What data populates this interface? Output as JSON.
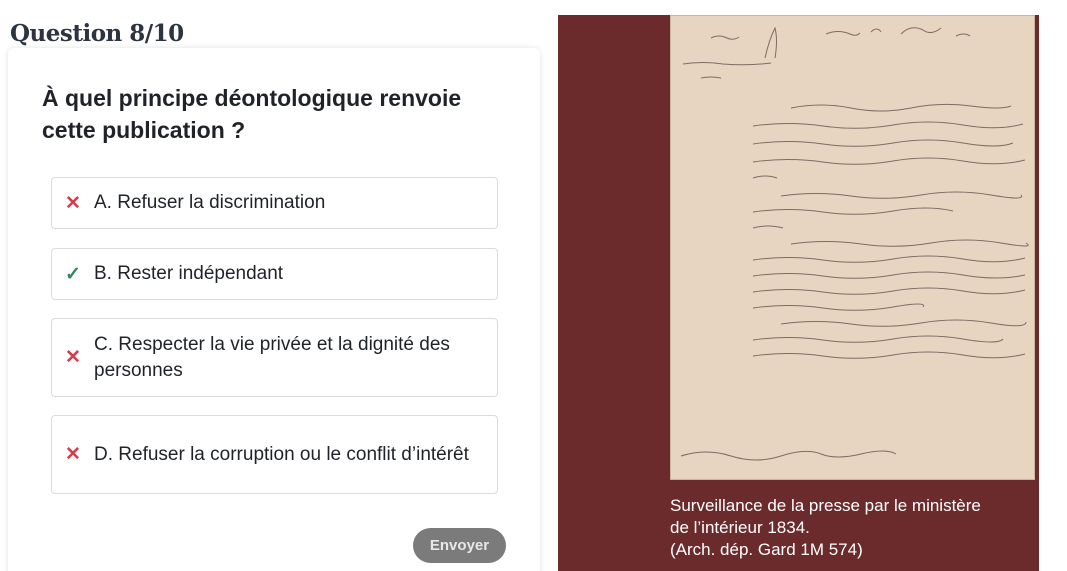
{
  "quiz": {
    "counter": "Question 8/10",
    "question": "À quel principe déontologique renvoie cette publication ?",
    "answers": [
      {
        "letter": "A.",
        "text": "A. Refuser la discrimination",
        "status": "wrong",
        "mark": "✕"
      },
      {
        "letter": "B.",
        "text": "B. Rester indépendant",
        "status": "correct",
        "mark": "✓"
      },
      {
        "letter": "C.",
        "text": "C. Respecter la vie privée et la dignité des personnes",
        "status": "wrong",
        "mark": "✕"
      },
      {
        "letter": "D.",
        "text": "D. Refuser la corruption ou le conflit d’intérêt",
        "status": "wrong",
        "mark": "✕"
      }
    ],
    "submit_label": "Envoyer"
  },
  "document": {
    "caption_line1": "Surveillance de la presse par le ministère",
    "caption_line2": "de l’intérieur 1834.",
    "caption_line3": "(Arch. dép. Gard 1M 574)"
  },
  "colors": {
    "panel_background": "#6b2b2d",
    "wrong_mark": "#d63c4c",
    "correct_mark": "#2e8b57",
    "button_background": "#7b7b7b"
  }
}
